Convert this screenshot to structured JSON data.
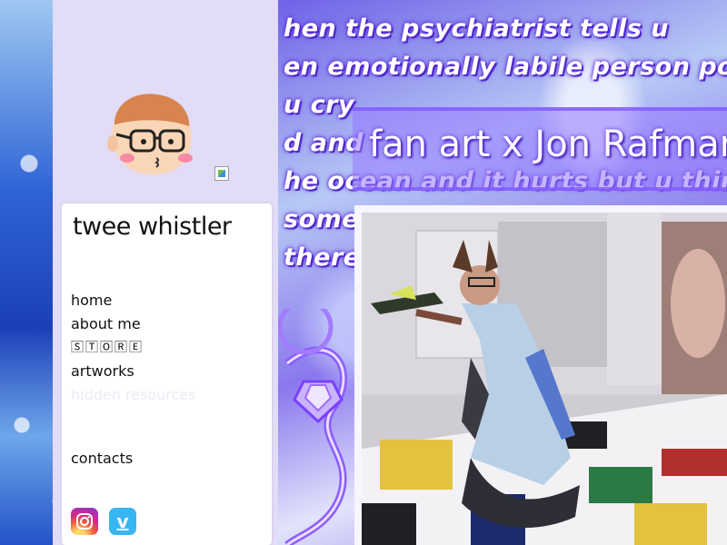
{
  "sidebar": {
    "site_title": "twee whistler",
    "nav": [
      {
        "label": "home"
      },
      {
        "label": "about me"
      },
      {
        "label": "🅂🅃🄾🅁🄴"
      },
      {
        "label": "artworks"
      },
      {
        "label": "hidden resources"
      },
      {
        "label": "contacts"
      }
    ],
    "social": [
      {
        "icon": "instagram-icon"
      },
      {
        "icon": "vimeo-icon",
        "glyph": "v"
      }
    ]
  },
  "marquee": [
    "hen the psychiatrist tells u",
    "en emotionally labile person pony",
    "u cry                              ",
    "d and",
    "he ocean and it hurts but u thin",
    "some",
    "there"
  ],
  "main": {
    "headline": "fan art x Jon Rafman"
  },
  "colors": {
    "sidebar_bg": "#e3dcf7",
    "accent_purple": "#5b2fdc",
    "vimeo_blue": "#39b5f0"
  }
}
